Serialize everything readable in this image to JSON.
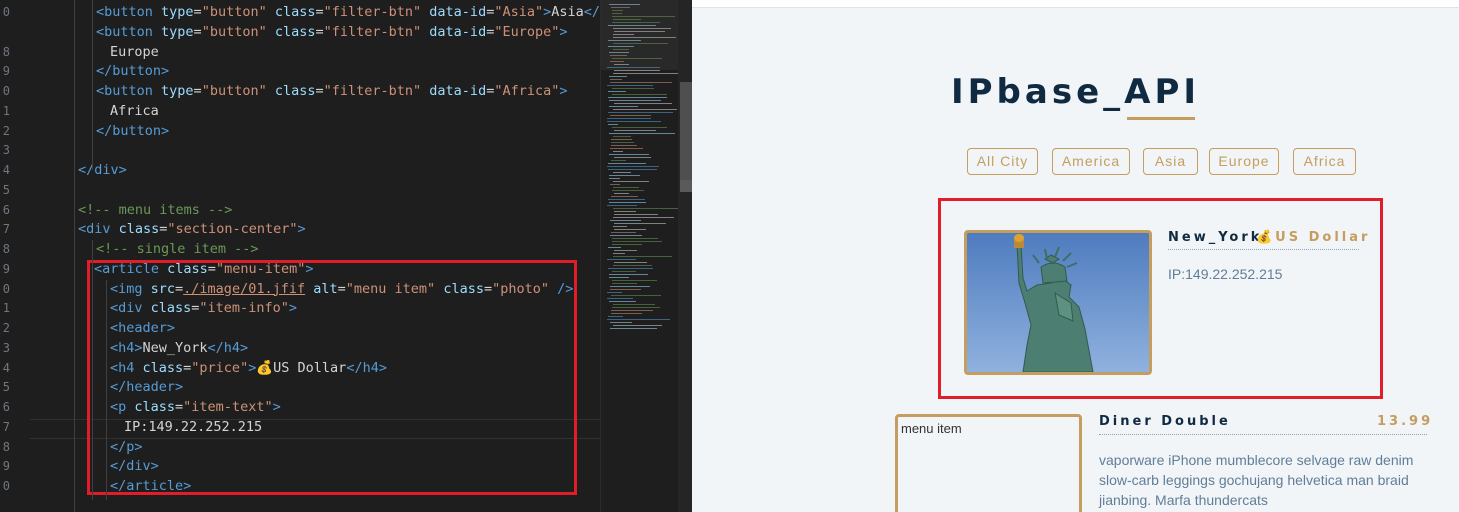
{
  "editor": {
    "line_numbers": [
      "0",
      "",
      "8",
      "9",
      "0",
      "1",
      "2",
      "3",
      "4",
      "5",
      "6",
      "7",
      "8",
      "9",
      "0",
      "1",
      "2",
      "3",
      "4",
      "5",
      "6",
      "7",
      "8",
      "9",
      "0"
    ],
    "lines": [
      [
        {
          "c": "t-tag",
          "t": "<button "
        },
        {
          "c": "t-attr",
          "t": "type"
        },
        {
          "c": "t-txt",
          "t": "="
        },
        {
          "c": "t-str",
          "t": "\"button\" "
        },
        {
          "c": "t-attr",
          "t": "class"
        },
        {
          "c": "t-txt",
          "t": "="
        },
        {
          "c": "t-str",
          "t": "\"filter-btn\" "
        },
        {
          "c": "t-attr",
          "t": "data-id"
        },
        {
          "c": "t-txt",
          "t": "="
        },
        {
          "c": "t-str",
          "t": "\"Asia\""
        },
        {
          "c": "t-tag",
          "t": ">"
        },
        {
          "c": "t-txt",
          "t": "Asia"
        },
        {
          "c": "t-tag",
          "t": "</b"
        }
      ],
      [
        {
          "c": "t-tag",
          "t": "<button "
        },
        {
          "c": "t-attr",
          "t": "type"
        },
        {
          "c": "t-txt",
          "t": "="
        },
        {
          "c": "t-str",
          "t": "\"button\" "
        },
        {
          "c": "t-attr",
          "t": "class"
        },
        {
          "c": "t-txt",
          "t": "="
        },
        {
          "c": "t-str",
          "t": "\"filter-btn\" "
        },
        {
          "c": "t-attr",
          "t": "data-id"
        },
        {
          "c": "t-txt",
          "t": "="
        },
        {
          "c": "t-str",
          "t": "\"Europe\""
        },
        {
          "c": "t-tag",
          "t": ">"
        }
      ],
      [
        {
          "c": "t-txt",
          "t": "Europe"
        }
      ],
      [
        {
          "c": "t-tag",
          "t": "</button>"
        }
      ],
      [
        {
          "c": "t-tag",
          "t": "<button "
        },
        {
          "c": "t-attr",
          "t": "type"
        },
        {
          "c": "t-txt",
          "t": "="
        },
        {
          "c": "t-str",
          "t": "\"button\" "
        },
        {
          "c": "t-attr",
          "t": "class"
        },
        {
          "c": "t-txt",
          "t": "="
        },
        {
          "c": "t-str",
          "t": "\"filter-btn\" "
        },
        {
          "c": "t-attr",
          "t": "data-id"
        },
        {
          "c": "t-txt",
          "t": "="
        },
        {
          "c": "t-str",
          "t": "\"Africa\""
        },
        {
          "c": "t-tag",
          "t": ">"
        }
      ],
      [
        {
          "c": "t-txt",
          "t": "Africa"
        }
      ],
      [
        {
          "c": "t-tag",
          "t": "</button>"
        }
      ],
      [],
      [
        {
          "c": "t-tag",
          "t": "</div>"
        }
      ],
      [],
      [
        {
          "c": "t-cmt",
          "t": "<!-- menu items -->"
        }
      ],
      [
        {
          "c": "t-tag",
          "t": "<div "
        },
        {
          "c": "t-attr",
          "t": "class"
        },
        {
          "c": "t-txt",
          "t": "="
        },
        {
          "c": "t-str",
          "t": "\"section-center\""
        },
        {
          "c": "t-tag",
          "t": ">"
        }
      ],
      [
        {
          "c": "t-cmt",
          "t": "<!-- single item -->"
        }
      ],
      [
        {
          "c": "t-tag",
          "t": "<article "
        },
        {
          "c": "t-attr",
          "t": "class"
        },
        {
          "c": "t-txt",
          "t": "="
        },
        {
          "c": "t-str",
          "t": "\"menu-item\""
        },
        {
          "c": "t-tag",
          "t": ">"
        }
      ],
      [
        {
          "c": "t-tag",
          "t": "<img "
        },
        {
          "c": "t-attr",
          "t": "src"
        },
        {
          "c": "t-txt",
          "t": "="
        },
        {
          "c": "t-link",
          "t": "./image/01.jfif"
        },
        {
          "c": "t-txt",
          "t": " "
        },
        {
          "c": "t-attr",
          "t": "alt"
        },
        {
          "c": "t-txt",
          "t": "="
        },
        {
          "c": "t-str",
          "t": "\"menu item\" "
        },
        {
          "c": "t-attr",
          "t": "class"
        },
        {
          "c": "t-txt",
          "t": "="
        },
        {
          "c": "t-str",
          "t": "\"photo\" "
        },
        {
          "c": "t-tag",
          "t": "/>"
        }
      ],
      [
        {
          "c": "t-tag",
          "t": "<div "
        },
        {
          "c": "t-attr",
          "t": "class"
        },
        {
          "c": "t-txt",
          "t": "="
        },
        {
          "c": "t-str",
          "t": "\"item-info\""
        },
        {
          "c": "t-tag",
          "t": ">"
        }
      ],
      [
        {
          "c": "t-tag",
          "t": "<header>"
        }
      ],
      [
        {
          "c": "t-tag",
          "t": "<h4>"
        },
        {
          "c": "t-txt",
          "t": "New_York"
        },
        {
          "c": "t-tag",
          "t": "</h4>"
        }
      ],
      [
        {
          "c": "t-tag",
          "t": "<h4 "
        },
        {
          "c": "t-attr",
          "t": "class"
        },
        {
          "c": "t-txt",
          "t": "="
        },
        {
          "c": "t-str",
          "t": "\"price\""
        },
        {
          "c": "t-tag",
          "t": ">"
        },
        {
          "c": "t-txt",
          "t": "💰US Dollar"
        },
        {
          "c": "t-tag",
          "t": "</h4>"
        }
      ],
      [
        {
          "c": "t-tag",
          "t": "</header>"
        }
      ],
      [
        {
          "c": "t-tag",
          "t": "<p "
        },
        {
          "c": "t-attr",
          "t": "class"
        },
        {
          "c": "t-txt",
          "t": "="
        },
        {
          "c": "t-str",
          "t": "\"item-text\""
        },
        {
          "c": "t-tag",
          "t": ">"
        }
      ],
      [
        {
          "c": "t-txt",
          "t": "IP:149.22.252.215"
        }
      ],
      [
        {
          "c": "t-tag",
          "t": "</p>"
        }
      ],
      [
        {
          "c": "t-tag",
          "t": "</div>"
        }
      ],
      [
        {
          "c": "t-tag",
          "t": "</article>"
        }
      ]
    ]
  },
  "preview": {
    "site_title": "IPbase_API",
    "filters": [
      "All City",
      "America",
      "Asia",
      "Europe",
      "Africa"
    ],
    "items": [
      {
        "title": "New_York",
        "price": "💰US Dollar",
        "text": "IP:149.22.252.215",
        "img_alt": ""
      },
      {
        "title": "Diner Double",
        "price": "13.99",
        "text": "vaporware iPhone mumblecore selvage raw denim slow-carb leggings gochujang helvetica man braid jianbing. Marfa thundercats",
        "img_alt": "menu item"
      }
    ],
    "colors": {
      "accent": "#c59d5f",
      "heading": "#102a42",
      "text": "#617d98",
      "highlight": "#e11d2a",
      "background": "#f1f5f8"
    }
  }
}
